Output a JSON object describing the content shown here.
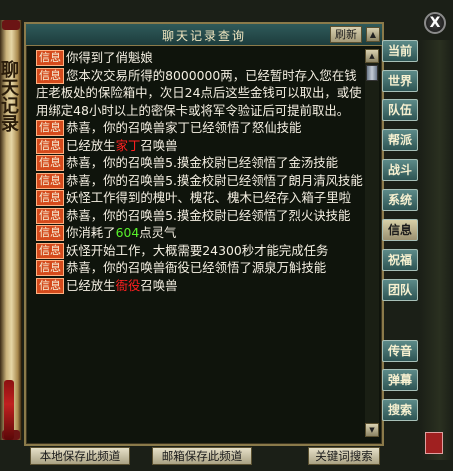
{
  "window": {
    "title": "聊天记录查询",
    "refresh_label": "刷新",
    "close_label": "X",
    "scroll_side_text": "聊天记录"
  },
  "tag_label": "信息",
  "messages": [
    {
      "parts": [
        {
          "text": "你得到了俏魁娘"
        }
      ]
    },
    {
      "parts": [
        {
          "text": "您本次交易所得的8000000两，已经暂时存入您在钱庄老板处的保险箱中，次日24点后这些金钱可以取出，或使用绑定48小时以上的密保卡或将军令验证后可提前取出。"
        }
      ]
    },
    {
      "parts": [
        {
          "text": "恭喜，你的召唤兽家丁已经领悟了怒仙技能"
        }
      ]
    },
    {
      "parts": [
        {
          "text": "已经放生"
        },
        {
          "text": "家丁",
          "color": "red"
        },
        {
          "text": "召唤兽"
        }
      ]
    },
    {
      "parts": [
        {
          "text": "恭喜，你的召唤兽5.摸金校尉已经领悟了金汤技能"
        }
      ]
    },
    {
      "parts": [
        {
          "text": "恭喜，你的召唤兽5.摸金校尉已经领悟了朗月清风技能"
        }
      ]
    },
    {
      "parts": [
        {
          "text": "妖怪工作得到的槐叶、槐花、槐木已经存入箱子里啦"
        }
      ]
    },
    {
      "parts": [
        {
          "text": "恭喜，你的召唤兽5.摸金校尉已经领悟了烈火诀技能"
        }
      ]
    },
    {
      "parts": [
        {
          "text": "你消耗了"
        },
        {
          "text": "604",
          "color": "green"
        },
        {
          "text": "点灵气"
        }
      ]
    },
    {
      "parts": [
        {
          "text": "妖怪开始工作，大概需要24300秒才能完成任务"
        }
      ]
    },
    {
      "parts": [
        {
          "text": "恭喜，你的召唤兽衙役已经领悟了源泉万斛技能"
        }
      ]
    },
    {
      "parts": [
        {
          "text": "已经放生"
        },
        {
          "text": "衙役",
          "color": "red"
        },
        {
          "text": "召唤兽"
        }
      ]
    }
  ],
  "side_buttons": [
    {
      "label": "当前",
      "active": false
    },
    {
      "label": "世界",
      "active": false
    },
    {
      "label": "队伍",
      "active": false
    },
    {
      "label": "帮派",
      "active": false
    },
    {
      "label": "战斗",
      "active": false
    },
    {
      "label": "系统",
      "active": false
    },
    {
      "label": "信息",
      "active": true
    },
    {
      "label": "祝福",
      "active": false
    },
    {
      "label": "团队",
      "active": false
    },
    {
      "label": "传音",
      "active": false
    },
    {
      "label": "弹幕",
      "active": false
    },
    {
      "label": "搜索",
      "active": false
    }
  ],
  "bottom_buttons": {
    "local_save": "本地保存此频道",
    "mail_save": "邮箱保存此频道",
    "keyword_search": "关键词搜索"
  },
  "colors": {
    "tag_bg": "#d44a1c",
    "highlight_red": "#ff2020",
    "highlight_green": "#58f02a"
  }
}
